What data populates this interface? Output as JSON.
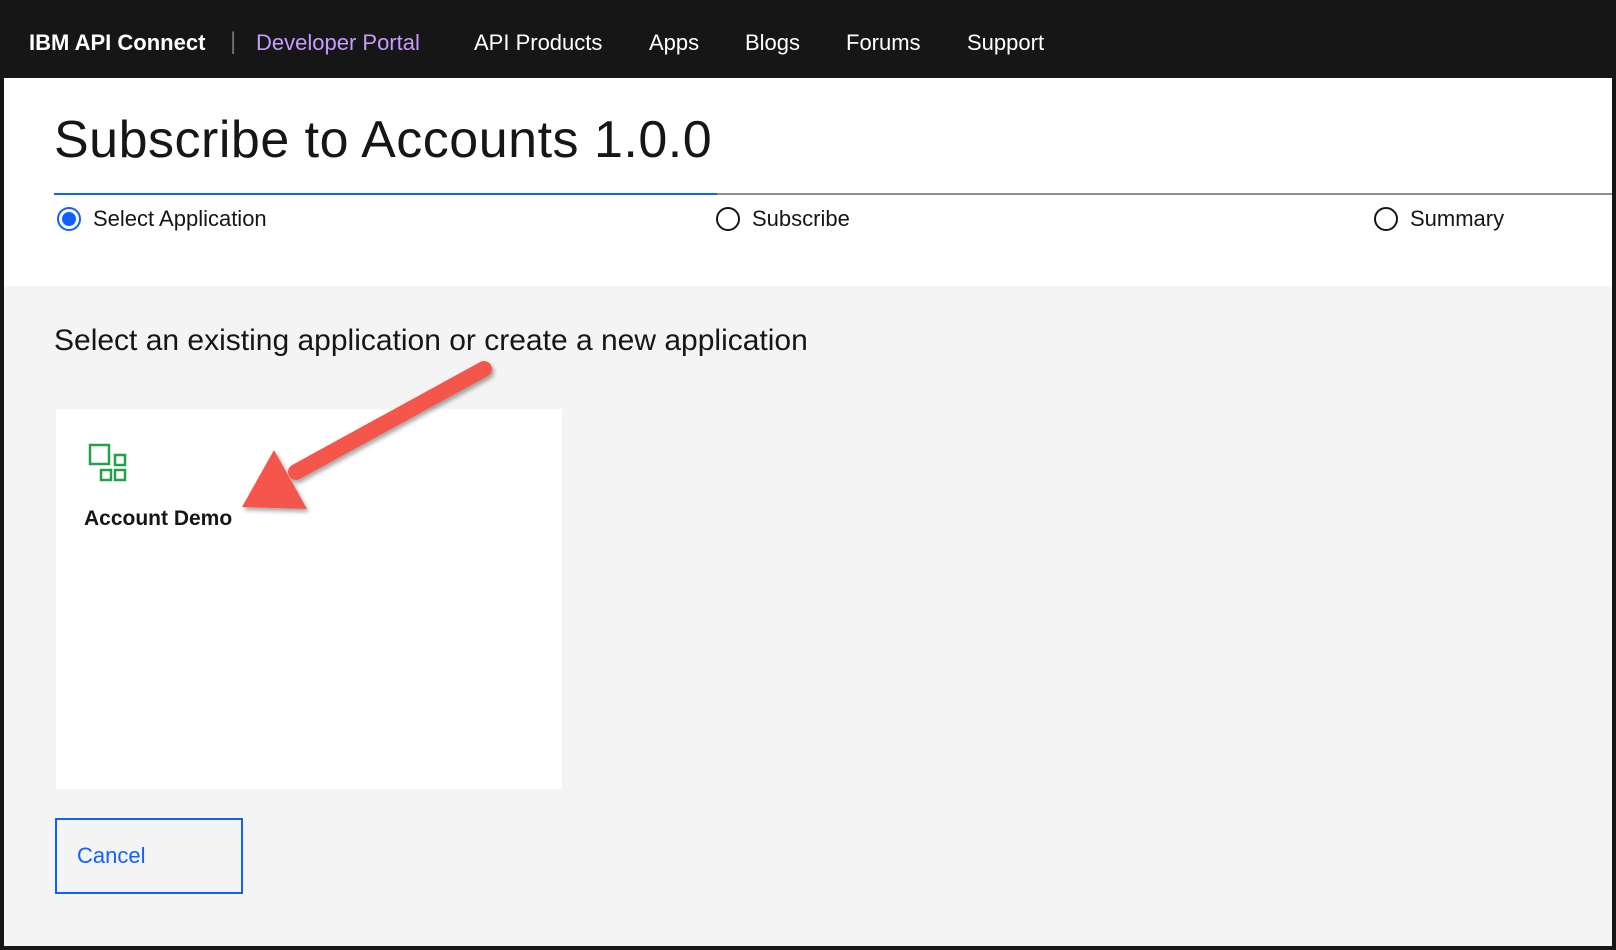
{
  "nav": {
    "brand": "IBM API Connect",
    "separator": "|",
    "portal": "Developer Portal",
    "links": [
      "API Products",
      "Apps",
      "Blogs",
      "Forums",
      "Support"
    ]
  },
  "header": {
    "title": "Subscribe to Accounts 1.0.0"
  },
  "steps": [
    {
      "label": "Select Application",
      "active": true
    },
    {
      "label": "Subscribe",
      "active": false
    },
    {
      "label": "Summary",
      "active": false
    }
  ],
  "main": {
    "section_title": "Select an existing application or create a new application",
    "apps": [
      {
        "name": "Account Demo",
        "icon": "application-icon"
      }
    ],
    "cancel_label": "Cancel"
  },
  "colors": {
    "nav_bg": "#161616",
    "portal_accent": "#c79bff",
    "primary": "#0f62fe",
    "app_icon": "#24a148",
    "annotation_arrow": "#f4574b"
  }
}
